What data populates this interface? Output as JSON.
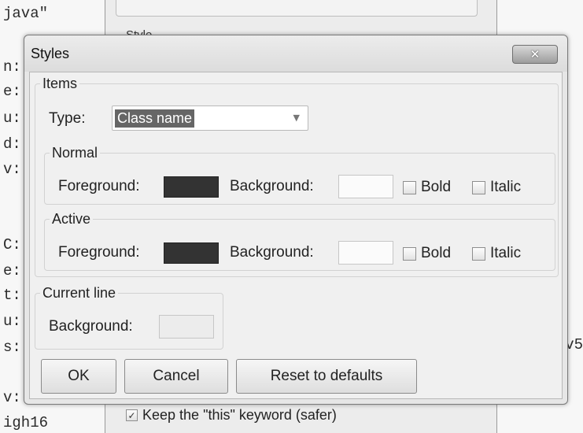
{
  "background": {
    "code_lines": [
      "java\"",
      "n:",
      "e:",
      "u:",
      "d:",
      "v:",
      "C:",
      "e:",
      "t:",
      "u:",
      "s:",
      "v:",
      "igh16"
    ],
    "code_right_fragment": "v5",
    "options_style_label": "Style",
    "keep_this_checkbox": {
      "label": "Keep the \"this\" keyword (safer)",
      "checked": true
    }
  },
  "dialog": {
    "title": "Styles",
    "close_symbol": "✕",
    "items_group": {
      "legend": "Items",
      "type_label": "Type:",
      "type_value": "Class name",
      "normal": {
        "legend": "Normal",
        "foreground_label": "Foreground:",
        "foreground_color": "#333333",
        "background_label": "Background:",
        "background_color": "#fbfbfb",
        "bold_label": "Bold",
        "bold_checked": false,
        "italic_label": "Italic",
        "italic_checked": false
      },
      "active": {
        "legend": "Active",
        "foreground_label": "Foreground:",
        "foreground_color": "#333333",
        "background_label": "Background:",
        "background_color": "#fbfbfb",
        "bold_label": "Bold",
        "bold_checked": false,
        "italic_label": "Italic",
        "italic_checked": false
      }
    },
    "current_line": {
      "legend": "Current line",
      "background_label": "Background:",
      "background_color": "#ececec"
    },
    "buttons": {
      "ok": "OK",
      "cancel": "Cancel",
      "reset": "Reset to defaults"
    }
  }
}
